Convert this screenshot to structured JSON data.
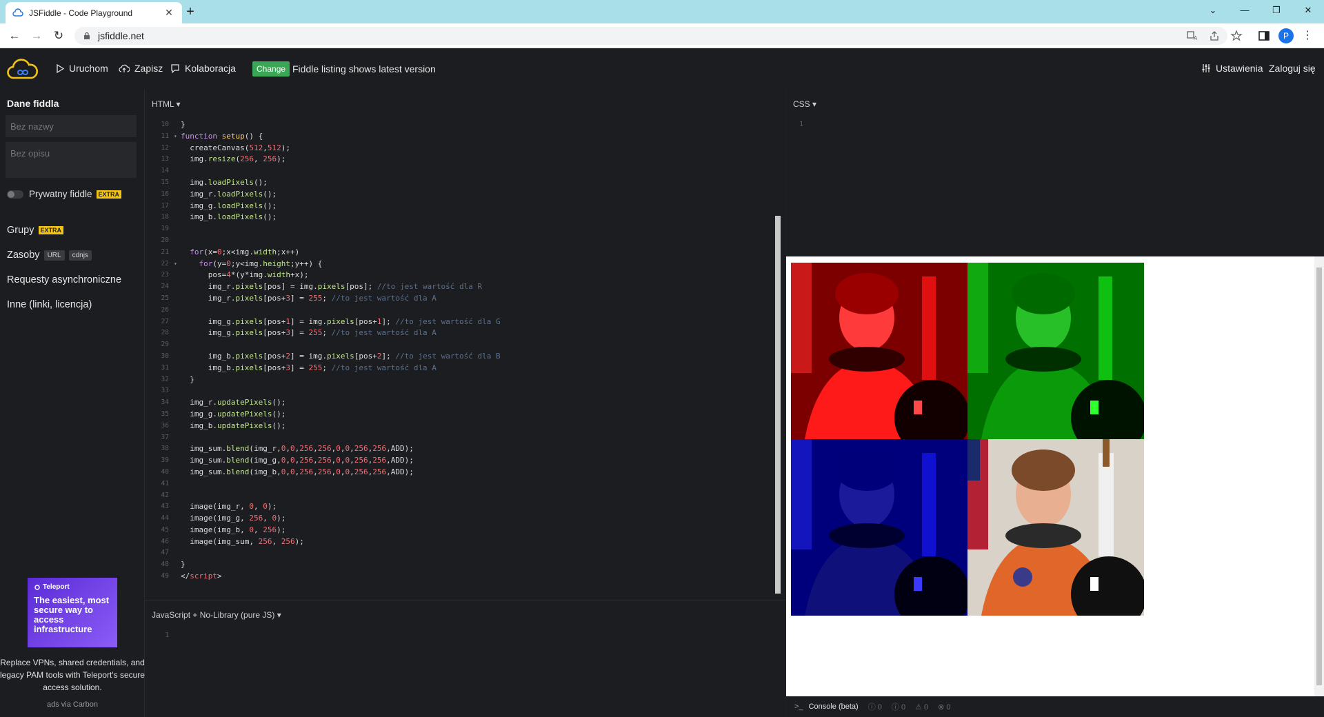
{
  "browser": {
    "tab_title": "JSFiddle - Code Playground",
    "url": "jsfiddle.net",
    "avatar_letter": "P"
  },
  "header": {
    "run_label": "Uruchom",
    "save_label": "Zapisz",
    "collab_label": "Kolaboracja",
    "change_badge": "Change",
    "change_text": "Fiddle listing shows latest version",
    "settings_label": "Ustawienia",
    "login_label": "Zaloguj się"
  },
  "sidebar": {
    "title": "Dane fiddla",
    "name_placeholder": "Bez nazwy",
    "desc_placeholder": "Bez opisu",
    "private_label": "Prywatny fiddle",
    "extra_tag": "EXTRA",
    "groups_label": "Grupy",
    "resources_label": "Zasoby",
    "url_tag": "URL",
    "cdnjs_tag": "cdnjs",
    "async_label": "Requesty asynchroniczne",
    "other_label": "Inne (linki, licencja)",
    "ad": {
      "brand": "Teleport",
      "headline": "The easiest, most secure way to access infrastructure",
      "desc": "Replace VPNs, shared credentials, and legacy PAM tools with Teleport's secure access solution.",
      "via": "ads via Carbon"
    }
  },
  "editors": {
    "html_title": "HTML ▾",
    "css_title": "CSS ▾",
    "js_title": "JavaScript + No-Library (pure JS) ▾",
    "css_line1": "1",
    "js_line1": "1"
  },
  "console": {
    "label": "Console (beta)",
    "counts": [
      "0",
      "0",
      "0",
      "0"
    ]
  },
  "colors": {
    "accent_green": "#3aa757",
    "logo_yellow": "#f2c416",
    "editor_bg": "#1c1d20"
  }
}
